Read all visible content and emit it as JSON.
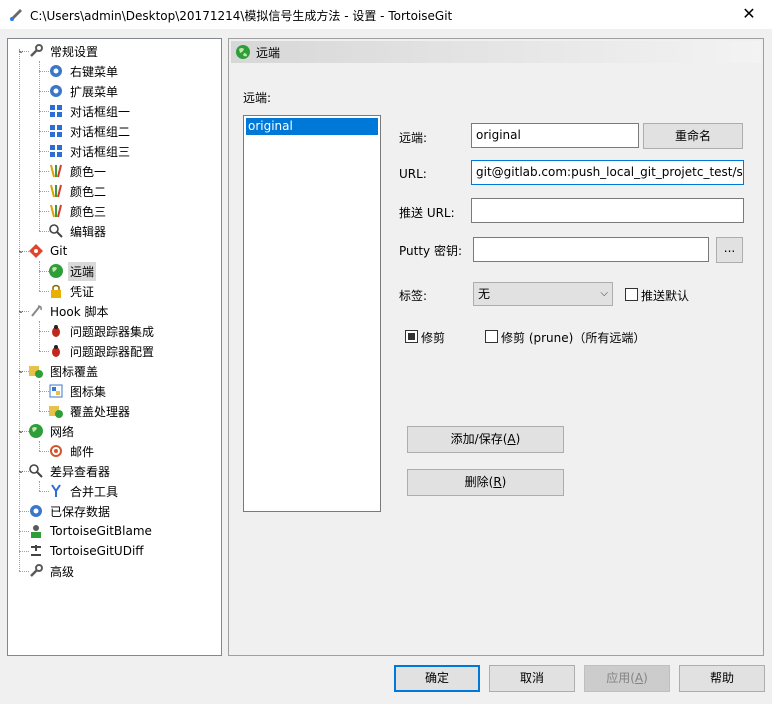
{
  "window": {
    "title": "C:\\Users\\admin\\Desktop\\20171214\\模拟信号生成方法 - 设置 - TortoiseGit",
    "close_glyph": "✕"
  },
  "tree": {
    "items": [
      {
        "label": "常规设置",
        "icon": "wrench-icon"
      },
      {
        "label": "右键菜单",
        "icon": "gear-icon"
      },
      {
        "label": "扩展菜单",
        "icon": "gear-icon"
      },
      {
        "label": "对话框组一",
        "icon": "windows-icon"
      },
      {
        "label": "对话框组二",
        "icon": "windows-icon"
      },
      {
        "label": "对话框组三",
        "icon": "windows-icon"
      },
      {
        "label": "颜色一",
        "icon": "color-palette-icon"
      },
      {
        "label": "颜色二",
        "icon": "color-palette-icon"
      },
      {
        "label": "颜色三",
        "icon": "color-palette-icon"
      },
      {
        "label": "编辑器",
        "icon": "magnifier-icon"
      },
      {
        "label": "Git",
        "icon": "git-icon"
      },
      {
        "label": "远端",
        "icon": "globe-icon"
      },
      {
        "label": "凭证",
        "icon": "lock-icon"
      },
      {
        "label": "Hook 脚本",
        "icon": "hook-icon"
      },
      {
        "label": "问题跟踪器集成",
        "icon": "bug-icon"
      },
      {
        "label": "问题跟踪器配置",
        "icon": "bug-icon"
      },
      {
        "label": "图标覆盖",
        "icon": "overlay-icon"
      },
      {
        "label": "图标集",
        "icon": "iconset-icon"
      },
      {
        "label": "覆盖处理器",
        "icon": "overlay-icon"
      },
      {
        "label": "网络",
        "icon": "globe-icon"
      },
      {
        "label": "邮件",
        "icon": "email-icon"
      },
      {
        "label": "差异查看器",
        "icon": "magnifier-icon"
      },
      {
        "label": "合并工具",
        "icon": "merge-icon"
      },
      {
        "label": "已保存数据",
        "icon": "gear-icon"
      },
      {
        "label": "TortoiseGitBlame",
        "icon": "blame-icon"
      },
      {
        "label": "TortoiseGitUDiff",
        "icon": "udiff-icon"
      },
      {
        "label": "高级",
        "icon": "wrench-icon"
      }
    ]
  },
  "remote_page": {
    "header": "远端",
    "list_label": "远端:",
    "remotes": [
      "original"
    ],
    "remote_label": "远端:",
    "remote_value": "original",
    "rename_button": "重命名",
    "url_label": "URL:",
    "url_value": "git@gitlab.com:push_local_git_projetc_test/sig",
    "push_url_label": "推送 URL:",
    "push_url_value": "",
    "putty_label": "Putty 密钥:",
    "putty_value": "",
    "browse_button": "...",
    "tags_label": "标签:",
    "tags_value": "无",
    "push_default_label": "推送默认",
    "prune_label": "修剪",
    "prune_all_label": "修剪 (prune)（所有远端）",
    "add_save_button": "添加/保存(",
    "add_save_key": "A",
    "delete_button": "删除(",
    "delete_key": "R"
  },
  "dialog_buttons": {
    "ok": "确定",
    "cancel": "取消",
    "apply": "应用(",
    "apply_key": "A",
    "help": "帮助"
  }
}
